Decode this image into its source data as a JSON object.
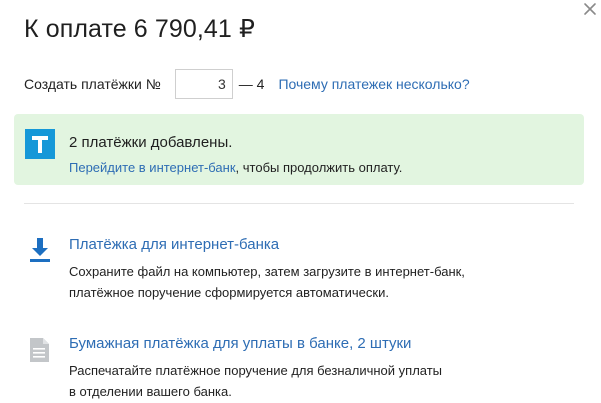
{
  "dialog": {
    "title": "К оплате 6 790,41 ₽",
    "close_label": "×"
  },
  "create_row": {
    "label": "Создать платёжки №",
    "from_value": "3",
    "range_to": "— 4",
    "why_link": "Почему платежек несколько?"
  },
  "banner": {
    "logo_letter": "Т",
    "title": "2 платёжки добавлены.",
    "link_text": "Перейдите в интернет-банк",
    "link_suffix": ", чтобы продолжить оплату."
  },
  "options": [
    {
      "icon": "download-icon",
      "title": "Платёжка для интернет-банка",
      "desc_line1": "Сохраните файл на компьютер, затем загрузите в интернет-банк,",
      "desc_line2": "платёжное поручение сформируется автоматически."
    },
    {
      "icon": "document-icon",
      "title": "Бумажная платёжка для уплаты в банке, 2 штуки",
      "desc_line1": "Распечатайте платёжное поручение для безналичной уплаты",
      "desc_line2": "в отделении вашего банка."
    }
  ],
  "colors": {
    "link": "#2e6db4",
    "banner_bg": "#e2f5e0",
    "logo_bg": "#1598d8",
    "icon_blue": "#1d6fc1",
    "icon_grey": "#b8bcc0"
  }
}
